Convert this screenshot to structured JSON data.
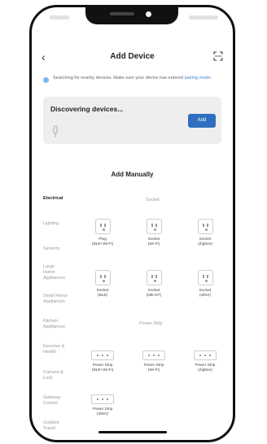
{
  "header": {
    "title": "Add Device",
    "back_icon": "chevron-left-icon",
    "scan_icon": "scan-icon"
  },
  "notice": {
    "text": "Searching for nearby devices. Make sure your device has entered ",
    "link": "pairing mode",
    "suffix": "."
  },
  "discovery": {
    "title": "Discovering devices...",
    "add_label": "Add"
  },
  "manual_title": "Add Manually",
  "categories": [
    {
      "label": "Electrical",
      "active": true
    },
    {
      "label": "Lighting",
      "active": false
    },
    {
      "label": "Sensors",
      "active": false
    },
    {
      "label": "Large Home Appliances",
      "active": false
    },
    {
      "label": "Small Home Appliances",
      "active": false
    },
    {
      "label": "Kitchen Appliances",
      "active": false
    },
    {
      "label": "Exercise & Health",
      "active": false
    },
    {
      "label": "Camera & Lock",
      "active": false
    },
    {
      "label": "Gateway Control",
      "active": false
    },
    {
      "label": "Outdoor Travel",
      "active": false
    }
  ],
  "sections": {
    "socket": "Socket",
    "power_strip": "Power Strip"
  },
  "devices": {
    "sockets": [
      {
        "name": "Plug",
        "protocol": "(BLE+Wi-Fi)"
      },
      {
        "name": "Socket",
        "protocol": "(Wi-Fi)"
      },
      {
        "name": "Socket",
        "protocol": "(Zigbee)"
      },
      {
        "name": "Socket",
        "protocol": "(BLE)"
      },
      {
        "name": "Socket",
        "protocol": "(NB-IoT)"
      },
      {
        "name": "Socket",
        "protocol": "(other)"
      }
    ],
    "strips": [
      {
        "name": "Power Strip",
        "protocol": "(BLE+Wi-Fi)"
      },
      {
        "name": "Power Strip",
        "protocol": "(Wi-Fi)"
      },
      {
        "name": "Power Strip",
        "protocol": "(Zigbee)"
      },
      {
        "name": "Power Strip",
        "protocol": "(other)"
      }
    ]
  }
}
